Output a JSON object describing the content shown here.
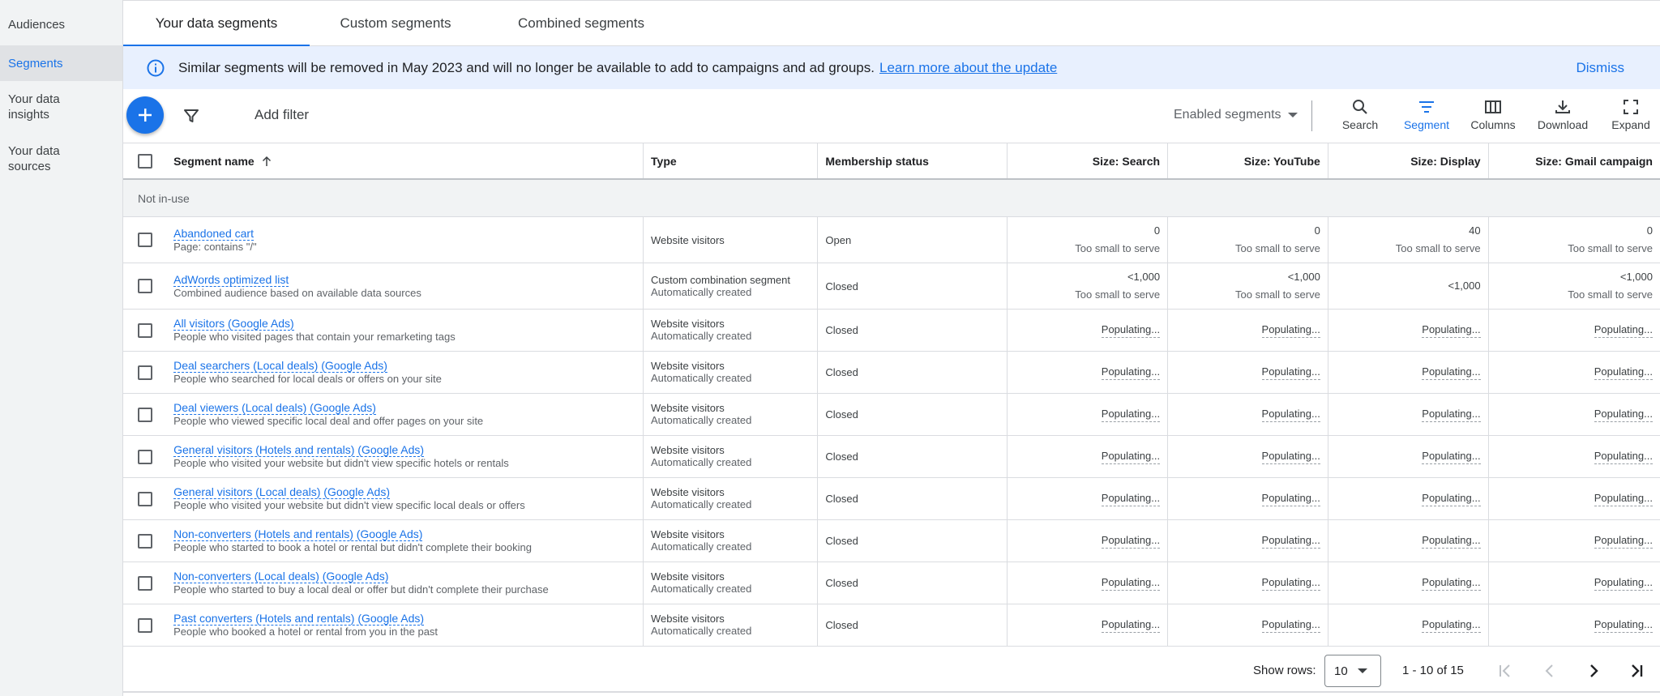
{
  "sidebar": {
    "items": [
      {
        "label": "Audiences"
      },
      {
        "label": "Segments"
      },
      {
        "label": "Your data insights"
      },
      {
        "label": "Your data sources"
      }
    ]
  },
  "tabs": [
    {
      "label": "Your data segments"
    },
    {
      "label": "Custom segments"
    },
    {
      "label": "Combined segments"
    }
  ],
  "banner": {
    "text": "Similar segments will be removed in May 2023 and will no longer be available to add to campaigns and ad groups.",
    "link": "Learn more about the update",
    "dismiss": "Dismiss"
  },
  "toolbar": {
    "add_filter": "Add filter",
    "enabled_segments": "Enabled segments",
    "tools": [
      {
        "label": "Search",
        "icon": "search-icon"
      },
      {
        "label": "Segment",
        "icon": "segment-icon"
      },
      {
        "label": "Columns",
        "icon": "columns-icon"
      },
      {
        "label": "Download",
        "icon": "download-icon"
      },
      {
        "label": "Expand",
        "icon": "expand-icon"
      }
    ]
  },
  "table": {
    "headers": {
      "name": "Segment name",
      "type": "Type",
      "membership": "Membership status",
      "search": "Size: Search",
      "youtube": "Size: YouTube",
      "display": "Size: Display",
      "gmail": "Size: Gmail campaign"
    },
    "group_label": "Not in-use",
    "rows": [
      {
        "name": "Abandoned cart",
        "desc": "Page: contains \"/\"",
        "type": "Website visitors",
        "type_sub": "",
        "status": "Open",
        "search": "0",
        "search_sub": "Too small to serve",
        "youtube": "0",
        "youtube_sub": "Too small to serve",
        "display": "40",
        "display_sub": "Too small to serve",
        "gmail": "0",
        "gmail_sub": "Too small to serve"
      },
      {
        "name": "AdWords optimized list",
        "desc": "Combined audience based on available data sources",
        "type": "Custom combination segment",
        "type_sub": "Automatically created",
        "status": "Closed",
        "search": "<1,000",
        "search_sub": "Too small to serve",
        "youtube": "<1,000",
        "youtube_sub": "Too small to serve",
        "display": "<1,000",
        "display_sub": "",
        "gmail": "<1,000",
        "gmail_sub": "Too small to serve"
      },
      {
        "name": "All visitors (Google Ads)",
        "desc": "People who visited pages that contain your remarketing tags",
        "type": "Website visitors",
        "type_sub": "Automatically created",
        "status": "Closed",
        "search": "Populating...",
        "search_sub": "",
        "youtube": "Populating...",
        "youtube_sub": "",
        "display": "Populating...",
        "display_sub": "",
        "gmail": "Populating...",
        "gmail_sub": ""
      },
      {
        "name": "Deal searchers (Local deals) (Google Ads)",
        "desc": "People who searched for local deals or offers on your site",
        "type": "Website visitors",
        "type_sub": "Automatically created",
        "status": "Closed",
        "search": "Populating...",
        "search_sub": "",
        "youtube": "Populating...",
        "youtube_sub": "",
        "display": "Populating...",
        "display_sub": "",
        "gmail": "Populating...",
        "gmail_sub": ""
      },
      {
        "name": "Deal viewers (Local deals) (Google Ads)",
        "desc": "People who viewed specific local deal and offer pages on your site",
        "type": "Website visitors",
        "type_sub": "Automatically created",
        "status": "Closed",
        "search": "Populating...",
        "search_sub": "",
        "youtube": "Populating...",
        "youtube_sub": "",
        "display": "Populating...",
        "display_sub": "",
        "gmail": "Populating...",
        "gmail_sub": ""
      },
      {
        "name": "General visitors (Hotels and rentals) (Google Ads)",
        "desc": "People who visited your website but didn't view specific hotels or rentals",
        "type": "Website visitors",
        "type_sub": "Automatically created",
        "status": "Closed",
        "search": "Populating...",
        "search_sub": "",
        "youtube": "Populating...",
        "youtube_sub": "",
        "display": "Populating...",
        "display_sub": "",
        "gmail": "Populating...",
        "gmail_sub": ""
      },
      {
        "name": "General visitors (Local deals) (Google Ads)",
        "desc": "People who visited your website but didn't view specific local deals or offers",
        "type": "Website visitors",
        "type_sub": "Automatically created",
        "status": "Closed",
        "search": "Populating...",
        "search_sub": "",
        "youtube": "Populating...",
        "youtube_sub": "",
        "display": "Populating...",
        "display_sub": "",
        "gmail": "Populating...",
        "gmail_sub": ""
      },
      {
        "name": "Non-converters (Hotels and rentals) (Google Ads)",
        "desc": "People who started to book a hotel or rental but didn't complete their booking",
        "type": "Website visitors",
        "type_sub": "Automatically created",
        "status": "Closed",
        "search": "Populating...",
        "search_sub": "",
        "youtube": "Populating...",
        "youtube_sub": "",
        "display": "Populating...",
        "display_sub": "",
        "gmail": "Populating...",
        "gmail_sub": ""
      },
      {
        "name": "Non-converters (Local deals) (Google Ads)",
        "desc": "People who started to buy a local deal or offer but didn't complete their purchase",
        "type": "Website visitors",
        "type_sub": "Automatically created",
        "status": "Closed",
        "search": "Populating...",
        "search_sub": "",
        "youtube": "Populating...",
        "youtube_sub": "",
        "display": "Populating...",
        "display_sub": "",
        "gmail": "Populating...",
        "gmail_sub": ""
      },
      {
        "name": "Past converters (Hotels and rentals) (Google Ads)",
        "desc": "People who booked a hotel or rental from you in the past",
        "type": "Website visitors",
        "type_sub": "Automatically created",
        "status": "Closed",
        "search": "Populating...",
        "search_sub": "",
        "youtube": "Populating...",
        "youtube_sub": "",
        "display": "Populating...",
        "display_sub": "",
        "gmail": "Populating...",
        "gmail_sub": ""
      }
    ]
  },
  "footer": {
    "show_rows_label": "Show rows:",
    "rows_value": "10",
    "range": "1 - 10 of 15"
  },
  "colors": {
    "accent": "#1a73e8",
    "banner_bg": "#e8f0fe",
    "sidebar_bg": "#f1f3f4"
  }
}
